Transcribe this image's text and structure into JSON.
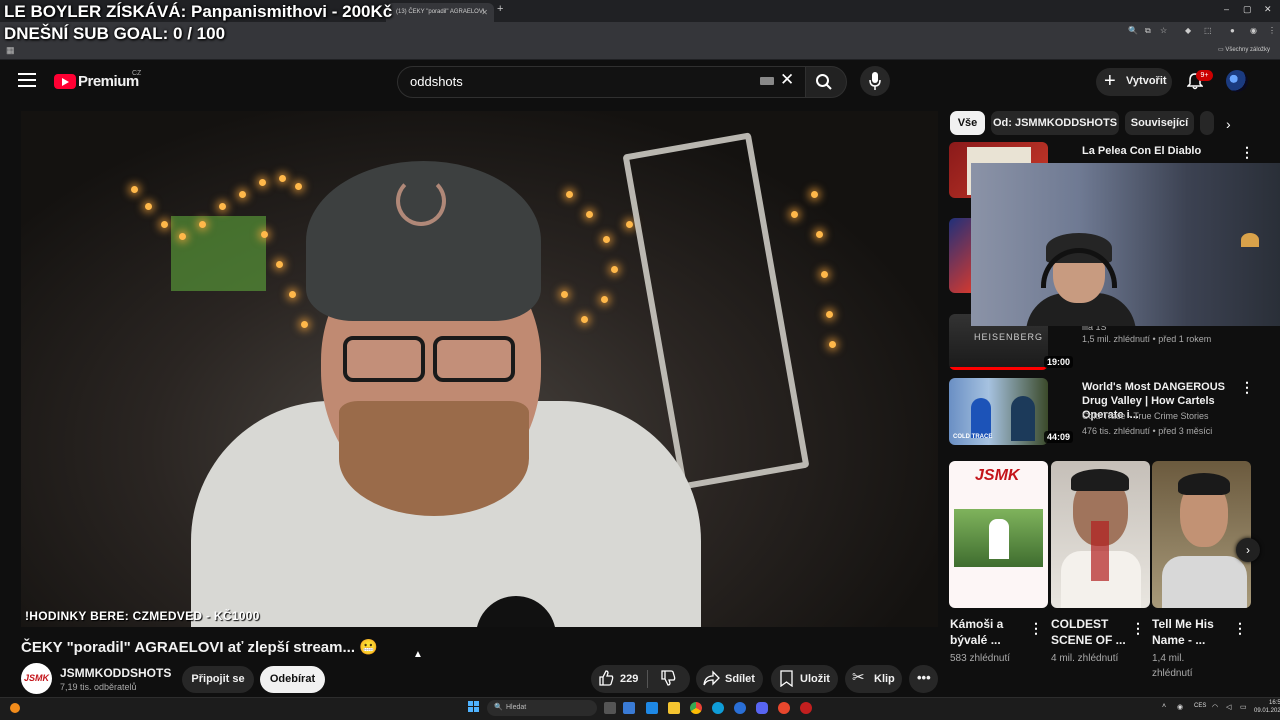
{
  "overlay": {
    "line1": "LE BOYLER ZÍSKÁVÁ: Panpanismithovi - 200Kč",
    "line2": "DNEŠNÍ SUB GOAL: 0 / 100"
  },
  "browser": {
    "active_tab_title": "(13) ČEKY \"poradil\" AGRAELOVI",
    "bookmarks_all": "Všechny záložky"
  },
  "header": {
    "logo_text": "Premium",
    "logo_country": "CZ",
    "search_value": "oddshots",
    "create_label": "Vytvořit",
    "notification_count": "9+"
  },
  "video": {
    "caption": "!HODINKY BERE: CZMEDVED - KČ1000",
    "title": "ČEKY \"poradil\" AGRAELOVI ať zlepší stream... 😬",
    "channel_name": "JSMMKODDSHOTS",
    "channel_subs": "7,19 tis. odběratelů",
    "join_label": "Připojit se",
    "subscribe_label": "Odebírat",
    "like_count": "229",
    "share_label": "Sdílet",
    "save_label": "Uložit",
    "clip_label": "Klip"
  },
  "chips": [
    "Vše",
    "Od: JSMMKODDSHOTS",
    "Související"
  ],
  "related": [
    {
      "title": "La Pelea Con El Diablo",
      "meta_line1": "",
      "meta_line2": ""
    },
    {
      "title": "",
      "meta_line1": "",
      "meta_line2": ""
    },
    {
      "title": "",
      "title_tail": "ilia 1S",
      "meta_line2": "1,5 mil. zhlédnutí • před 1 rokem",
      "duration": "19:00",
      "thumb_text": "HEISENBERG"
    },
    {
      "title": "World's Most DANGEROUS Drug Valley | How Cartels Operate i...",
      "meta_line1": "Cold Trace - True Crime Stories",
      "meta_line2": "476 tis. zhlédnutí • před 3 měsíci",
      "duration": "44:09",
      "thumb_text": "COLD TRACE"
    }
  ],
  "shorts": [
    {
      "title": "Kámoši a bývalé ...",
      "views": "583 zhlédnutí",
      "thumb_text": "JSMK"
    },
    {
      "title": "COLDEST SCENE OF ...",
      "views": "4 mil. zhlédnutí"
    },
    {
      "title": "Tell Me His Name - ...",
      "views": "1,4 mil. zhlédnutí"
    }
  ],
  "taskbar": {
    "search_placeholder": "Hledat",
    "lang": "CES",
    "time": "16:53",
    "date": "09.01.2026"
  },
  "colors": {
    "background": "#0f0f0f",
    "brand_red": "#ff0033",
    "chip_active": "#f1f1f1",
    "chip": "#272727"
  }
}
